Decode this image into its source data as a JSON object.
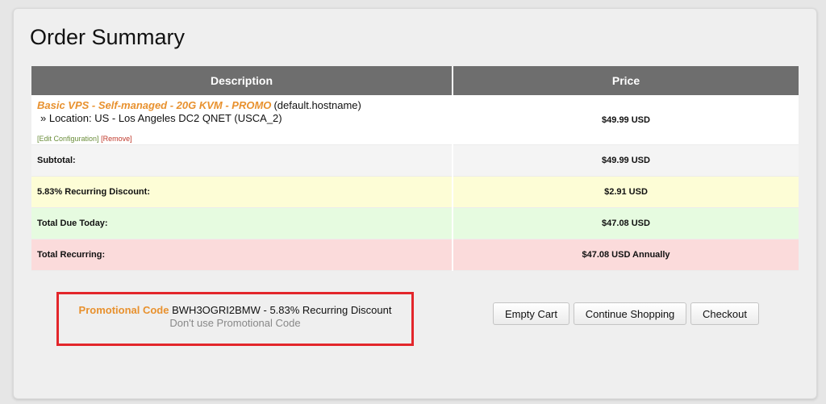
{
  "page": {
    "title": "Order Summary"
  },
  "table": {
    "headers": {
      "description": "Description",
      "price": "Price"
    },
    "product": {
      "name": "Basic VPS - Self-managed - 20G KVM - PROMO",
      "hostname": "(default.hostname)",
      "location": "» Location: US - Los Angeles DC2 QNET (USCA_2)",
      "edit_label": "[Edit Configuration]",
      "remove_label": "[Remove]",
      "price": "$49.99 USD"
    },
    "summary": [
      {
        "label": "Subtotal:",
        "value": "$49.99 USD"
      },
      {
        "label": "5.83% Recurring Discount:",
        "value": "$2.91 USD"
      },
      {
        "label": "Total Due Today:",
        "value": "$47.08 USD"
      },
      {
        "label": "Total Recurring:",
        "value": "$47.08 USD Annually"
      }
    ]
  },
  "promo": {
    "label": "Promotional Code",
    "code_text": "BWH3OGRI2BMW - 5.83% Recurring Discount",
    "remove_label": "Don't use Promotional Code"
  },
  "actions": {
    "empty_cart": "Empty Cart",
    "continue_shopping": "Continue Shopping",
    "checkout": "Checkout"
  },
  "colors": {
    "accent_orange": "#e8912e",
    "header_gray": "#6e6e6e",
    "discount_row": "#fdfdd6",
    "today_row": "#e6fbe0",
    "recurring_row": "#fbdbdb",
    "highlight_border": "#e3262b"
  }
}
